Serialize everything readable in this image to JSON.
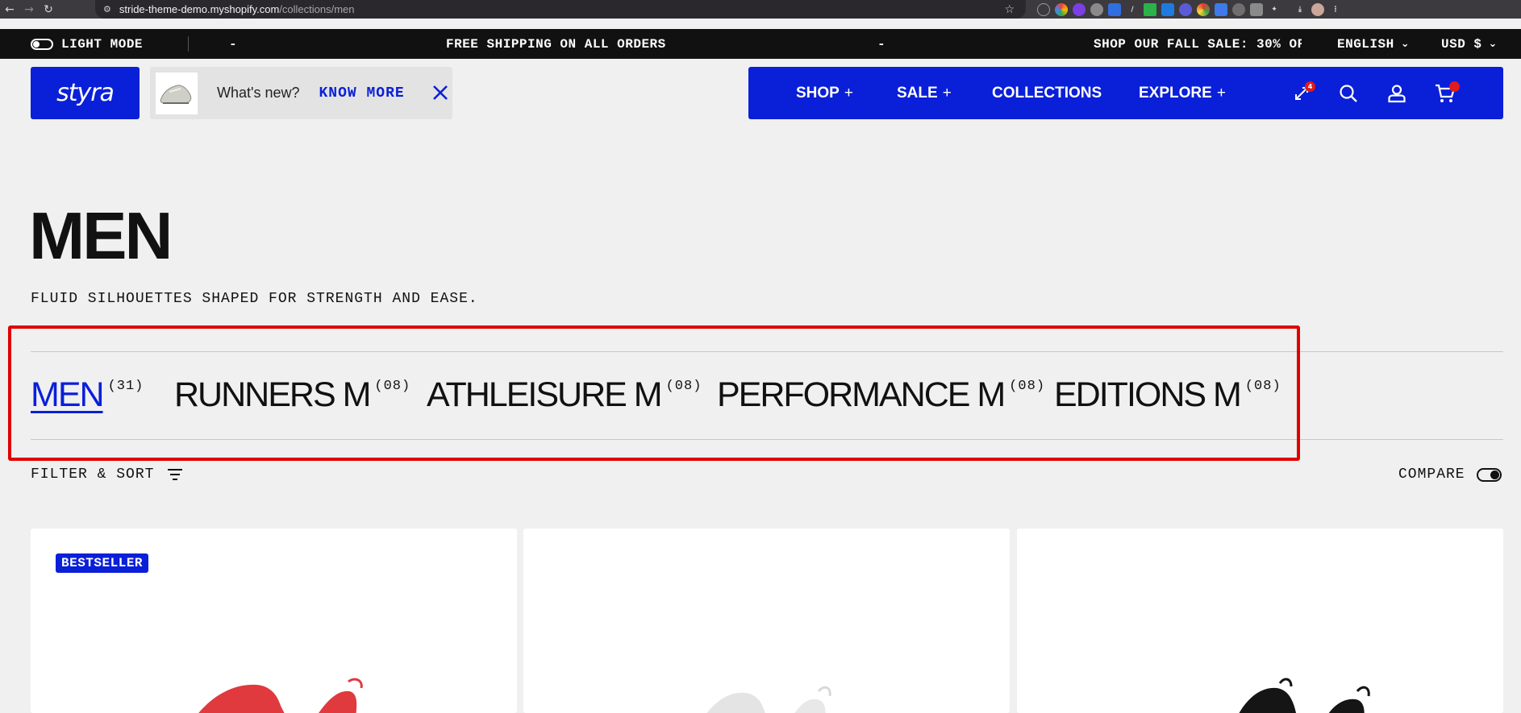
{
  "browser": {
    "url_host": "stride-theme-demo.myshopify.com",
    "url_path": "/collections/men"
  },
  "announcement": {
    "mode_label": "LIGHT MODE",
    "separator_left": "-",
    "shipping_text": "FREE SHIPPING ON ALL ORDERS",
    "separator_right": "-",
    "sale_text": "SHOP OUR FALL SALE: 30% OF",
    "language": "ENGLISH",
    "currency": "USD $"
  },
  "header": {
    "logo_text": "styra",
    "whats_new_label": "What's new?",
    "know_more_label": "KNOW MORE",
    "nav": [
      {
        "label": "SHOP",
        "suffix": "+"
      },
      {
        "label": "SALE",
        "suffix": "+"
      },
      {
        "label": "COLLECTIONS",
        "suffix": ""
      },
      {
        "label": "EXPLORE",
        "suffix": "+"
      }
    ],
    "compare_count": "4",
    "accent_color": "#0a1fd8",
    "badge_color": "#e11b1b"
  },
  "page": {
    "title": "MEN",
    "subtitle": "FLUID SILHOUETTES SHAPED FOR STRENGTH AND EASE."
  },
  "collection_tabs": [
    {
      "label": "MEN",
      "count": "(31)",
      "active": true
    },
    {
      "label": "RUNNERS M",
      "count": "(08)",
      "active": false
    },
    {
      "label": "ATHLEISURE M",
      "count": "(08)",
      "active": false
    },
    {
      "label": "PERFORMANCE M",
      "count": "(08)",
      "active": false
    },
    {
      "label": "EDITIONS M",
      "count": "(08)",
      "active": false
    }
  ],
  "toolbar": {
    "filter_label": "FILTER & SORT",
    "compare_label": "COMPARE"
  },
  "products": [
    {
      "badge": "BESTSELLER",
      "shoe_color": "#e03a3e"
    },
    {
      "badge": "",
      "shoe_color": "#e8e8e8"
    },
    {
      "badge": "",
      "shoe_color": "#151515"
    }
  ],
  "icons": [
    "back-icon",
    "forward-icon",
    "reload-icon",
    "site-settings-icon",
    "bookmark-star-icon",
    "dark-mode-toggle-icon",
    "chevron-down-icon",
    "close-icon",
    "compare-icon",
    "search-icon",
    "account-icon",
    "cart-icon",
    "filter-icon"
  ]
}
